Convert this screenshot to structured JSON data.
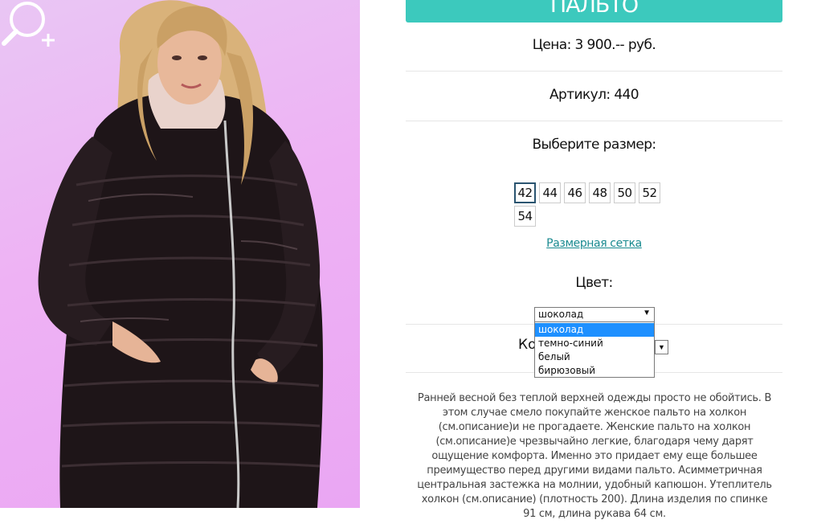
{
  "product": {
    "title": "ПАЛЬТО",
    "price": "Цена: 3 900.-- руб.",
    "article": "Артикул: 440",
    "choose_size": "Выберите размер:",
    "sizes": [
      {
        "label": "42",
        "selected": true
      },
      {
        "label": "44",
        "selected": false
      },
      {
        "label": "46",
        "selected": false
      },
      {
        "label": "48",
        "selected": false
      },
      {
        "label": "50",
        "selected": false
      },
      {
        "label": "52",
        "selected": false
      },
      {
        "label": "54",
        "selected": false
      }
    ],
    "size_chart_link": "Размерная сетка",
    "color_label": "Цвет:",
    "color_select": {
      "value": "шоколад",
      "options": [
        "шоколад",
        "темно-синий",
        "белый",
        "бирюзовый"
      ],
      "highlighted": "шоколад"
    },
    "quantity_label_partial": "Ко",
    "description": "Ранней весной без теплой верхней одежды просто не обойтись. В этом случае смело покупайте женское пальто на холкон (см.описание)и не прогадаете. Женские пальто на холкон (см.описание)е чрезвычайно легкие, благодаря чему дарят ощущение комфорта. Именно это придает ему еще большее преимущество перед другими видами пальто. Асимметричная центральная застежка на молнии, удобный капюшон. Утеплитель холкон (см.описание) (плотность 200). Длина изделия по спинке 91 см, длина рукава 64 см."
  },
  "colors": {
    "accent": "#3cc9bd",
    "link": "#1a8a90",
    "photo_bg": "#eeb2f4",
    "dropdown_highlight": "#1e90ff"
  },
  "icons": {
    "zoom": "zoom-in-icon",
    "select_arrow": "caret-down-icon"
  }
}
